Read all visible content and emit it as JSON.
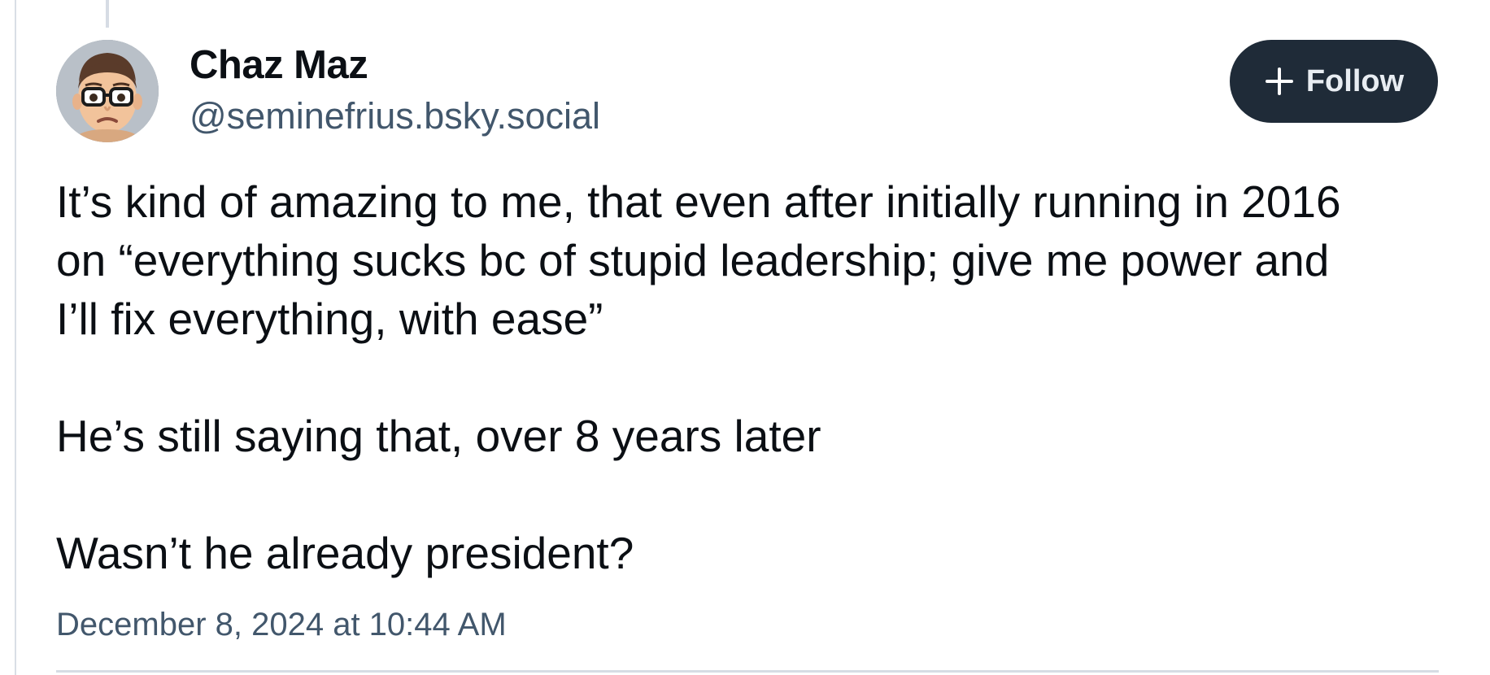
{
  "post": {
    "author": {
      "display_name": "Chaz Maz",
      "handle": "@seminefrius.bsky.social",
      "avatar_icon": "memoji-avatar-icon"
    },
    "follow_button": {
      "label": "Follow",
      "icon": "plus-icon"
    },
    "paragraphs": [
      "It’s kind of amazing to me, that even after initially running in 2016\non “everything sucks bc of stupid leadership; give me power and\nI’ll fix everything, with ease”",
      "He’s still saying that, over 8 years later",
      "Wasn’t he already president?"
    ],
    "timestamp": "December 8, 2024 at 10:44 AM"
  },
  "colors": {
    "button_bg": "#1f2b38",
    "text_primary": "#0b0f14",
    "text_secondary": "#42576c",
    "divider": "#d6dce4"
  }
}
